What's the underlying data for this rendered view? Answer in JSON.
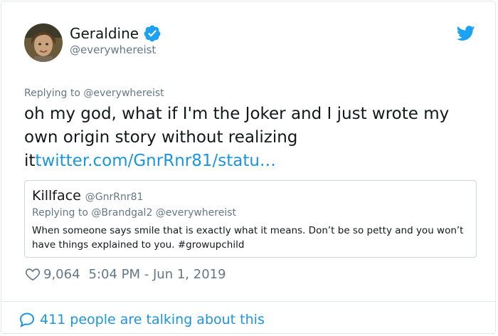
{
  "author": {
    "name": "Geraldine",
    "handle": "@everywhereist",
    "verified": true
  },
  "tweet": {
    "replying_prefix": "Replying to",
    "replying_handle": "@everywhereist",
    "text": "oh my god, what if I'm the Joker and I just wrote my own origin story without realizing it",
    "link": "twitter.com/GnrRnr81/statu…"
  },
  "quoted_tweet": {
    "name": "Killface",
    "handle": "@GnrRnr81",
    "replying_prefix": "Replying to",
    "replying_handles": "@Brandgal2 @everywhereist",
    "text": "When someone says smile that is exactly what it means. Don’t be so petty and you won’t have things explained to you. #growupchild"
  },
  "meta": {
    "likes": "9,064",
    "timestamp": "5:04 PM - Jun 1, 2019"
  },
  "footer": {
    "talking_label": "411 people are talking about this"
  },
  "colors": {
    "link": "#1b95e0",
    "muted": "#657786",
    "verified": "#1da1f2"
  },
  "icons": [
    "avatar",
    "verified-badge-icon",
    "twitter-bird-icon",
    "heart-icon",
    "speech-bubble-icon"
  ]
}
